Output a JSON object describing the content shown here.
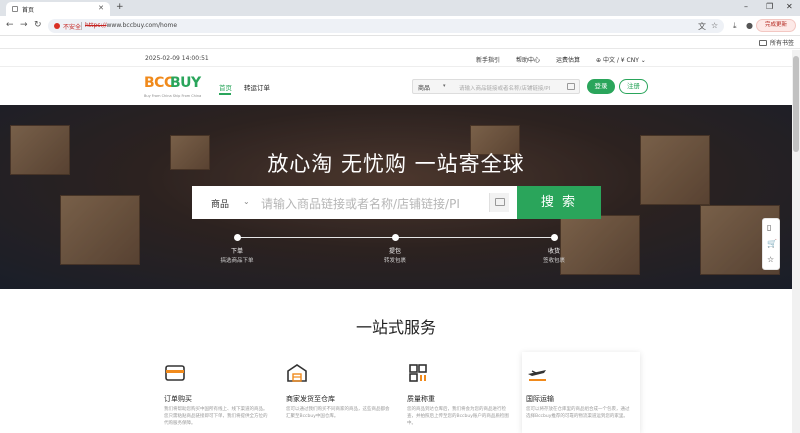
{
  "browser": {
    "tab_title": "首页",
    "insecure_label": "不安全",
    "url_scheme": "https://",
    "url_rest": "www.bccbuy.com/home",
    "update_label": "完成更新",
    "bookmarks_label": "所有书签"
  },
  "site": {
    "time": "2025-02-09 14:00:51",
    "top_links": [
      "新手指引",
      "帮助中心",
      "运费估算",
      "中文 / ¥ CNY"
    ],
    "logo_left": "BCC",
    "logo_right": "BUY",
    "logo_slogan": "Buy From China Ship From China",
    "nav": [
      "首页",
      "转运订单"
    ],
    "header_search": {
      "category": "商品",
      "placeholder": "请输入商品链接或者名称/店铺链接/PI"
    },
    "login_label": "登录",
    "register_label": "注册"
  },
  "hero": {
    "title": "放心淘 无忧购 一站寄全球",
    "search": {
      "category": "商品",
      "placeholder": "请输入商品链接或者名称/店铺链接/PI",
      "button": "搜 索"
    },
    "steps": [
      {
        "title": "下单",
        "sub": "搞选商品下单"
      },
      {
        "title": "提包",
        "sub": "转发包裹"
      },
      {
        "title": "收货",
        "sub": "签收包裹"
      }
    ]
  },
  "services": {
    "title": "一站式服务",
    "cards": [
      {
        "name": "订单购买",
        "desc": "我们将帮助您购买中国所有线上、线下渠道的商品。您只需粘贴商品链接即可下单，我们将提供全方位的代购服务保障。",
        "icon": "card-icon"
      },
      {
        "name": "商家发货至仓库",
        "desc": "您可以通过我们购买不同商家的商品，这些商品都会汇聚至Bccbuy中国仓库。",
        "icon": "warehouse-icon"
      },
      {
        "name": "质量称重",
        "desc": "您的商品到达仓库后，我们将会为您的商品进行检查，并拍照后上传至您的Bccbuy账户的商品质检图中。",
        "icon": "qrcode-icon"
      },
      {
        "name": "国际运输",
        "desc": "您可以将存放在仓库里的商品组合成一个包裹，通过选择Bccbuy推荐的可靠的物流渠道运到您的家里。",
        "icon": "plane-icon"
      }
    ]
  },
  "colors": {
    "brand_green": "#2aa55b",
    "brand_orange": "#f08a1c"
  }
}
